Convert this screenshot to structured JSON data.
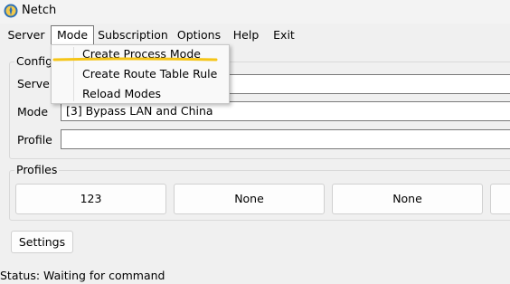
{
  "window": {
    "title": "Netch"
  },
  "menubar": {
    "items": [
      {
        "label": "Server"
      },
      {
        "label": "Mode"
      },
      {
        "label": "Subscription"
      },
      {
        "label": "Options"
      },
      {
        "label": "Help"
      },
      {
        "label": "Exit"
      }
    ],
    "active": "Mode"
  },
  "mode_menu": {
    "items": [
      {
        "label": "Create Process Mode"
      },
      {
        "label": "Create Route Table Rule"
      },
      {
        "label": "Reload Modes"
      }
    ]
  },
  "config": {
    "group_label": "Config",
    "server_label": "Server",
    "server_value": "",
    "mode_label": "Mode",
    "mode_value": "[3] Bypass LAN and China",
    "profile_label": "Profile",
    "profile_value": ""
  },
  "profiles": {
    "group_label": "Profiles",
    "buttons": [
      {
        "label": "123"
      },
      {
        "label": "None"
      },
      {
        "label": "None"
      },
      {
        "label": ""
      }
    ]
  },
  "settings_button": {
    "label": "Settings"
  },
  "status": {
    "text": "Status: Waiting for command"
  },
  "colors": {
    "highlight_stroke": "#f5c518",
    "window_bg": "#f0f0f0"
  }
}
